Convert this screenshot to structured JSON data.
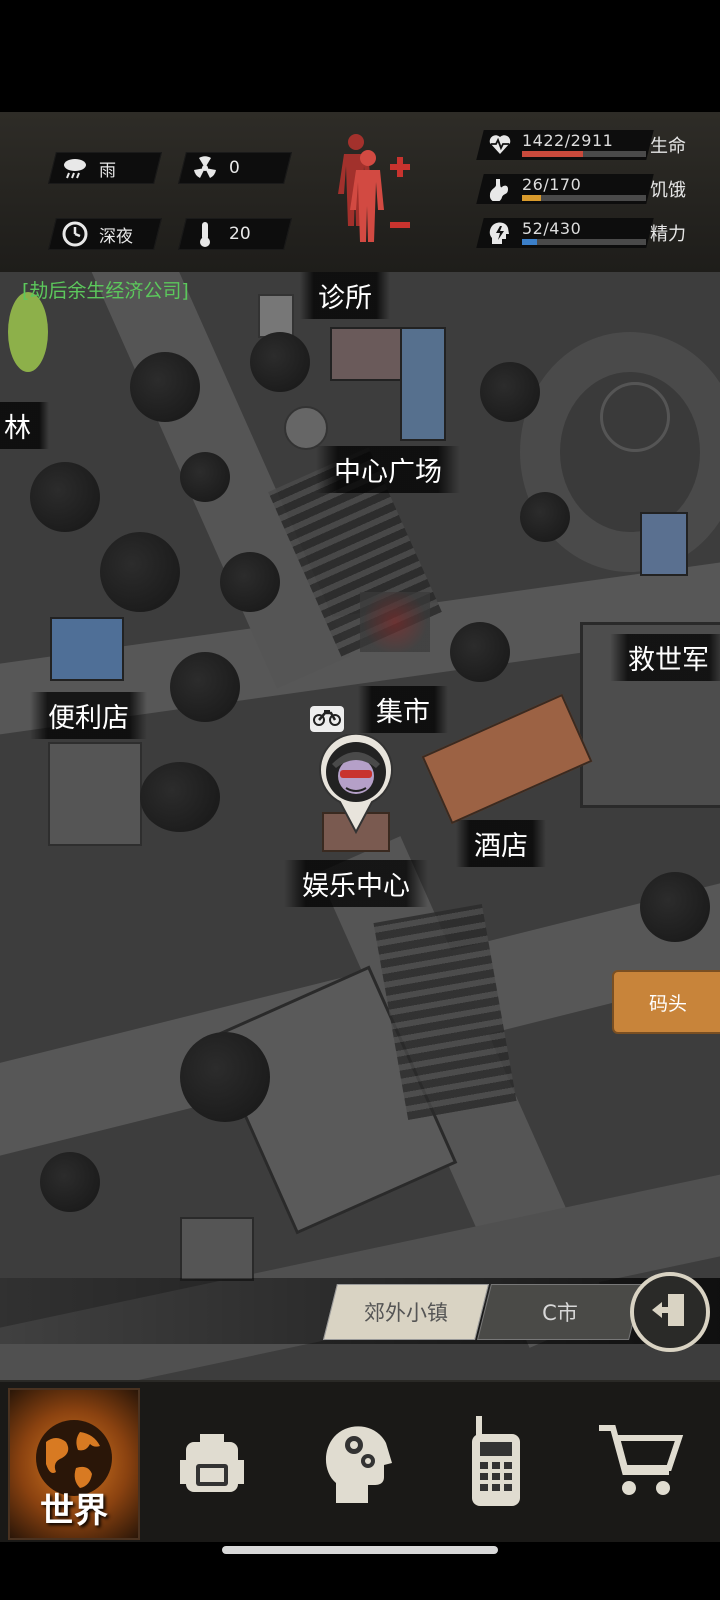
{
  "hud": {
    "weather": {
      "icon": "rain-cloud-icon",
      "text": "雨"
    },
    "radiation": {
      "icon": "radiation-icon",
      "text": "0"
    },
    "time": {
      "icon": "clock-icon",
      "text": "深夜"
    },
    "temperature": {
      "icon": "thermometer-icon",
      "text": "20"
    },
    "stats": [
      {
        "icon": "heart-pulse-icon",
        "value": "1422/2911",
        "label": "生命",
        "fraction": 0.488,
        "color": "#c94a3c"
      },
      {
        "icon": "stomach-icon",
        "value": "26/170",
        "label": "饥饿",
        "fraction": 0.153,
        "color": "#d89a2c"
      },
      {
        "icon": "head-energy-icon",
        "value": "52/430",
        "label": "精力",
        "fraction": 0.121,
        "color": "#3b7fc9"
      }
    ]
  },
  "map": {
    "company_label": "[劫后余生经济公司]",
    "locations": {
      "clinic": "诊所",
      "plaza": "中心广场",
      "left_edge": "林",
      "convenience": "便利店",
      "market": "集市",
      "salvation": "救世军",
      "hotel": "酒店",
      "entertainment": "娱乐中心",
      "dock": "码头"
    },
    "region_tabs": [
      "郊外小镇",
      "C市"
    ]
  },
  "nav": {
    "world_label": "世界",
    "items": [
      "globe-icon",
      "backpack-icon",
      "brain-head-icon",
      "radio-icon",
      "cart-icon"
    ]
  }
}
